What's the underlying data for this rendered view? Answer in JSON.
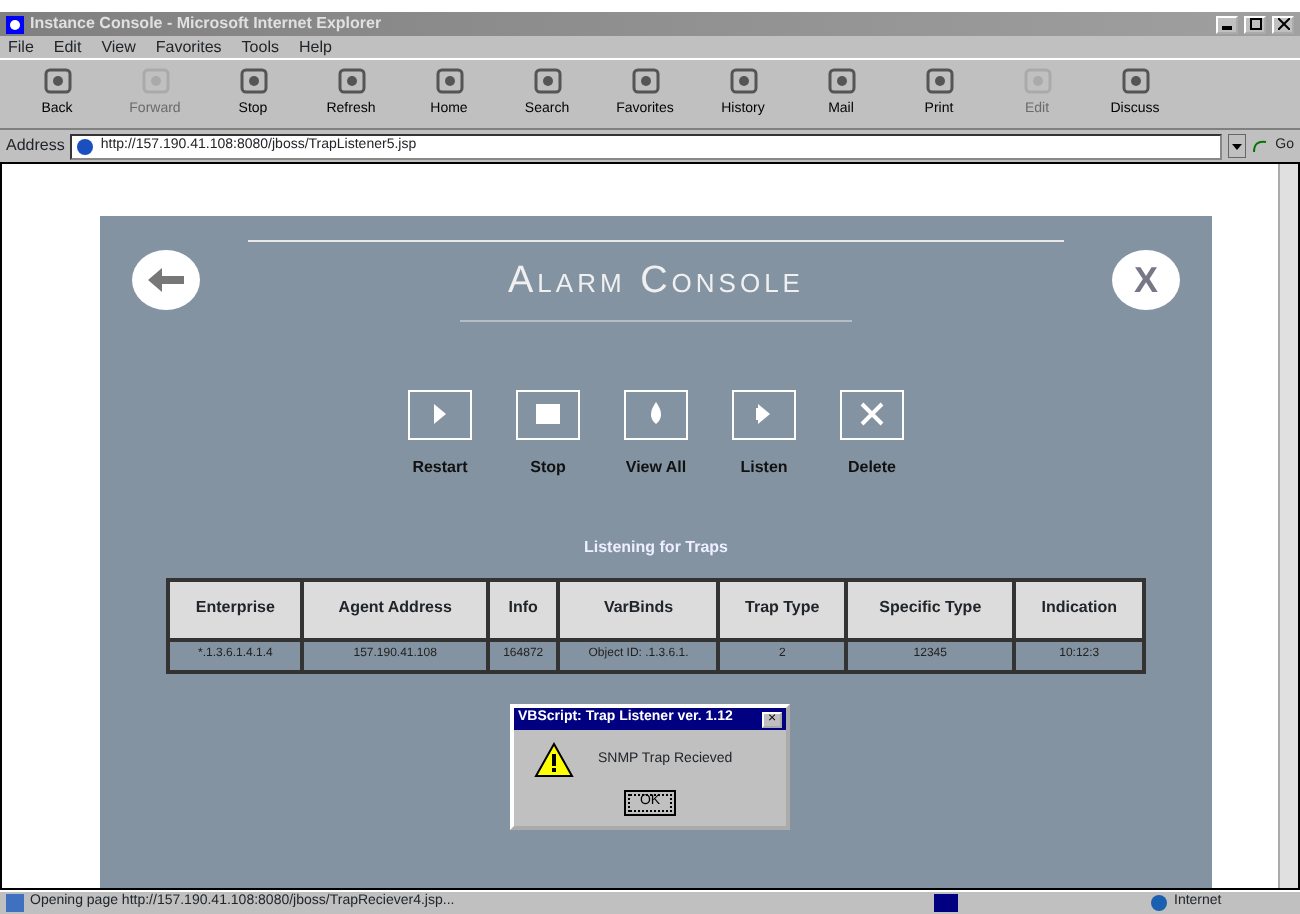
{
  "window": {
    "title": "Instance Console - Microsoft Internet Explorer"
  },
  "menu": [
    "File",
    "Edit",
    "View",
    "Favorites",
    "Tools",
    "Help"
  ],
  "toolbar": [
    {
      "label": "Back",
      "disabled": false
    },
    {
      "label": "Forward",
      "disabled": true
    },
    {
      "label": "Stop",
      "disabled": false
    },
    {
      "label": "Refresh",
      "disabled": false
    },
    {
      "label": "Home",
      "disabled": false
    },
    {
      "label": "Search",
      "disabled": false
    },
    {
      "label": "Favorites",
      "disabled": false
    },
    {
      "label": "History",
      "disabled": false
    },
    {
      "label": "Mail",
      "disabled": false
    },
    {
      "label": "Print",
      "disabled": false
    },
    {
      "label": "Edit",
      "disabled": true
    },
    {
      "label": "Discuss",
      "disabled": false
    }
  ],
  "address": {
    "label": "Address",
    "value": "http://157.190.41.108:8080/jboss/TrapListener5.jsp",
    "go": "Go"
  },
  "page": {
    "title": "Alarm Console",
    "close": "X",
    "actions": [
      {
        "label": "Restart",
        "kind": "play"
      },
      {
        "label": "Stop",
        "kind": "stop"
      },
      {
        "label": "View All",
        "kind": "drop"
      },
      {
        "label": "Listen",
        "kind": "listen"
      },
      {
        "label": "Delete",
        "kind": "delete"
      }
    ],
    "caption": "Listening for Traps",
    "table": {
      "columns": [
        "Enterprise",
        "Agent Address",
        "Info",
        "VarBinds",
        "Trap Type",
        "Specific Type",
        "Indication"
      ],
      "rows": [
        [
          "*.1.3.6.1.4.1.4",
          "157.190.41.108",
          "164872",
          "Object ID: .1.3.6.1.",
          "2",
          "12345",
          "10:12:3"
        ]
      ]
    }
  },
  "dialog": {
    "title": "VBScript: Trap Listener ver. 1.12",
    "close": "×",
    "message": "SNMP Trap Recieved",
    "button": "OK"
  },
  "status_bar": {
    "text": "Opening page http://157.190.41.108:8080/jboss/TrapReciever4.jsp...",
    "zone": "Internet"
  }
}
